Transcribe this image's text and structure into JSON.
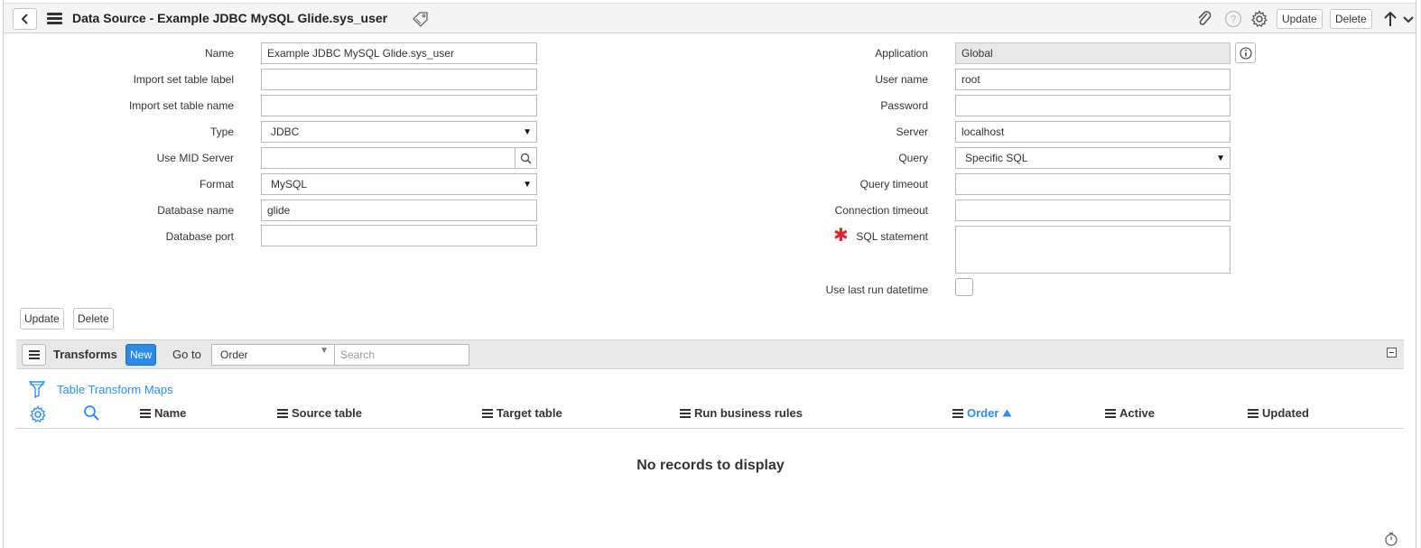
{
  "header": {
    "title": "Data Source - Example JDBC MySQL Glide.sys_user",
    "update_label": "Update",
    "delete_label": "Delete"
  },
  "form": {
    "left": {
      "name": {
        "label": "Name",
        "value": "Example JDBC MySQL Glide.sys_user"
      },
      "import_label": {
        "label": "Import set table label",
        "value": ""
      },
      "import_name": {
        "label": "Import set table name",
        "value": ""
      },
      "type": {
        "label": "Type",
        "value": "JDBC"
      },
      "mid_server": {
        "label": "Use MID Server",
        "value": ""
      },
      "format": {
        "label": "Format",
        "value": "MySQL"
      },
      "db_name": {
        "label": "Database name",
        "value": "glide"
      },
      "db_port": {
        "label": "Database port",
        "value": ""
      }
    },
    "right": {
      "application": {
        "label": "Application",
        "value": "Global"
      },
      "user_name": {
        "label": "User name",
        "value": "root"
      },
      "password": {
        "label": "Password",
        "value": ""
      },
      "server": {
        "label": "Server",
        "value": "localhost"
      },
      "query": {
        "label": "Query",
        "value": "Specific SQL"
      },
      "query_timeout": {
        "label": "Query timeout",
        "value": ""
      },
      "connection_timeout": {
        "label": "Connection timeout",
        "value": ""
      },
      "sql_statement": {
        "label": "SQL statement",
        "value": ""
      },
      "use_last_run": {
        "label": "Use last run datetime",
        "checked": false
      }
    },
    "buttons": {
      "update": "Update",
      "delete": "Delete"
    }
  },
  "related_list": {
    "title": "Transforms",
    "new_label": "New",
    "goto_label": "Go to",
    "goto_value": "Order",
    "search_placeholder": "Search",
    "filter_label": "Table Transform Maps",
    "columns": [
      "Name",
      "Source table",
      "Target table",
      "Run business rules",
      "Order",
      "Active",
      "Updated"
    ],
    "sorted_column": "Order",
    "sort_direction": "ascending",
    "empty_message": "No records to display"
  },
  "colors": {
    "accent": "#278efc",
    "new_button": "#2b8be9",
    "required": "#e0242e",
    "header_bg": "#f4f4f4",
    "list_bar_bg": "#e8e8e8"
  },
  "icons": [
    "back-arrow-icon",
    "hamburger-menu-icon",
    "tag-icon",
    "paperclip-icon",
    "help-icon",
    "gear-icon",
    "up-arrow-icon",
    "chevron-down-icon",
    "search-icon",
    "info-icon",
    "filter-icon",
    "timer-icon"
  ]
}
